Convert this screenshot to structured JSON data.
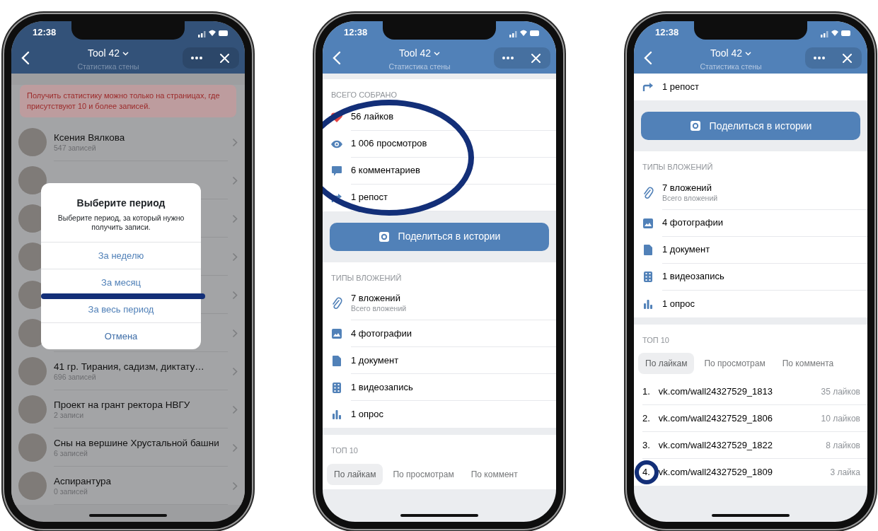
{
  "phones": [
    {
      "kind": "wall_list",
      "dimmed": true,
      "status_time": "12:38",
      "header": {
        "title": "Tool 42",
        "subtitle": "Статистика стены"
      },
      "notice": "Получить статистику можно только на страницах, где присутствуют 10 и более записей.",
      "communities": [
        {
          "kind": "entry",
          "name": "Ксения Вялкова",
          "count": "547 записей"
        },
        {
          "kind": "covered"
        },
        {
          "kind": "covered"
        },
        {
          "kind": "covered"
        },
        {
          "kind": "covered"
        },
        {
          "kind": "covered"
        },
        {
          "kind": "entry",
          "name": "41 гр. Тирания, садизм, диктату…",
          "count": "696 записей"
        },
        {
          "kind": "entry",
          "name": "Проект на грант ректора НВГУ",
          "count": "2 записи"
        },
        {
          "kind": "entry",
          "name": "Сны на вершине Хрустальной башни",
          "count": "6 записей"
        },
        {
          "kind": "entry",
          "name": "Аспирантура",
          "count": "0 записей"
        }
      ],
      "dialog": {
        "title": "Выберите период",
        "text": "Выберите период, за который нужно получить записи.",
        "options": [
          {
            "kind": "option",
            "label": "За неделю"
          },
          {
            "kind": "option",
            "label": "За месяц"
          },
          {
            "kind": "option",
            "label": "За весь период"
          },
          {
            "kind": "cancel",
            "label": "Отмена"
          }
        ]
      }
    },
    {
      "kind": "stats",
      "dimmed": false,
      "status_time": "12:38",
      "header": {
        "title": "Tool 42",
        "subtitle": "Статистика стены"
      },
      "totals": {
        "heading": "ВСЕГО СОБРАНО",
        "rows": [
          {
            "kind": "likes",
            "text": "56 лайков"
          },
          {
            "kind": "views",
            "text": "1 006 просмотров"
          },
          {
            "kind": "comments",
            "text": "6 комментариев"
          },
          {
            "kind": "reposts",
            "text": "1 репост"
          }
        ]
      },
      "share_button": "Поделиться в истории",
      "attachments": {
        "heading": "ТИПЫ ВЛОЖЕНИЙ",
        "rows": [
          {
            "kind": "all",
            "text": "7 вложений",
            "subtitle": "Всего вложений"
          },
          {
            "kind": "photos",
            "text": "4 фотографии"
          },
          {
            "kind": "docs",
            "text": "1 документ"
          },
          {
            "kind": "videos",
            "text": "1 видеозапись"
          },
          {
            "kind": "polls",
            "text": "1 опрос"
          }
        ]
      },
      "top": {
        "heading": "ТОП 10",
        "tabs": [
          {
            "label": "По лайкам",
            "selected": true
          },
          {
            "label": "По просмотрам",
            "selected": false
          },
          {
            "label": "По коммент",
            "selected": false
          }
        ]
      }
    },
    {
      "kind": "stats",
      "dimmed": false,
      "status_time": "12:38",
      "header": {
        "title": "Tool 42",
        "subtitle": "Статистика стены"
      },
      "totals": {
        "rows": [
          {
            "kind": "reposts",
            "text": "1 репост"
          }
        ]
      },
      "share_button": "Поделиться в истории",
      "attachments": {
        "heading": "ТИПЫ ВЛОЖЕНИЙ",
        "rows": [
          {
            "kind": "all",
            "text": "7 вложений",
            "subtitle": "Всего вложений"
          },
          {
            "kind": "photos",
            "text": "4 фотографии"
          },
          {
            "kind": "docs",
            "text": "1 документ"
          },
          {
            "kind": "videos",
            "text": "1 видеозапись"
          },
          {
            "kind": "polls",
            "text": "1 опрос"
          }
        ]
      },
      "top": {
        "heading": "ТОП 10",
        "tabs": [
          {
            "label": "По лайкам",
            "selected": true
          },
          {
            "label": "По просмотрам",
            "selected": false
          },
          {
            "label": "По коммента",
            "selected": false
          }
        ],
        "entries": [
          {
            "rank": "1.",
            "link": "vk.com/wall24327529_1813",
            "likes": "35 лайков"
          },
          {
            "rank": "2.",
            "link": "vk.com/wall24327529_1806",
            "likes": "10 лайков"
          },
          {
            "rank": "3.",
            "link": "vk.com/wall24327529_1822",
            "likes": "8 лайков"
          },
          {
            "rank": "4.",
            "link": "vk.com/wall24327529_1809",
            "likes": "3 лайка"
          }
        ]
      }
    }
  ]
}
